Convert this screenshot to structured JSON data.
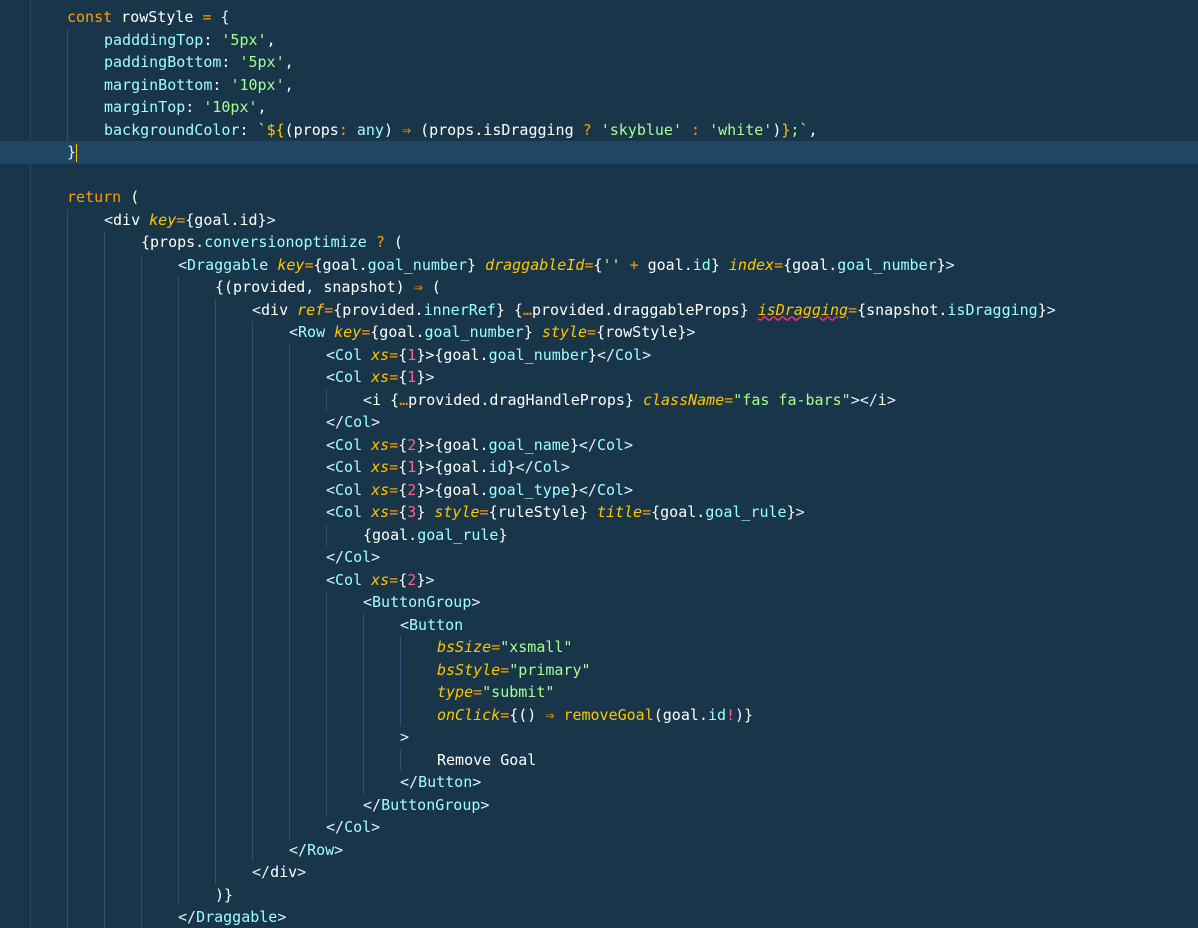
{
  "editor": {
    "theme_colors": {
      "background": "#193549",
      "current_line": "#1f4662",
      "keyword": "#ff9d00",
      "string": "#a5ff90",
      "number": "#ff628c",
      "tag": "#9effff",
      "attribute": "#ffc600"
    },
    "lines": [
      {
        "indent": 1,
        "tokens": [
          [
            "kw",
            "const"
          ],
          [
            "plain",
            " rowStyle "
          ],
          [
            "op",
            "="
          ],
          [
            "plain",
            " "
          ],
          [
            "punc",
            "{"
          ]
        ]
      },
      {
        "indent": 2,
        "tokens": [
          [
            "prop",
            "padddingTop"
          ],
          [
            "plain",
            ": "
          ],
          [
            "str",
            "'5px'"
          ],
          [
            "plain",
            ","
          ]
        ]
      },
      {
        "indent": 2,
        "tokens": [
          [
            "prop",
            "paddingBottom"
          ],
          [
            "plain",
            ": "
          ],
          [
            "str",
            "'5px'"
          ],
          [
            "plain",
            ","
          ]
        ]
      },
      {
        "indent": 2,
        "tokens": [
          [
            "prop",
            "marginBottom"
          ],
          [
            "plain",
            ": "
          ],
          [
            "str",
            "'10px'"
          ],
          [
            "plain",
            ","
          ]
        ]
      },
      {
        "indent": 2,
        "tokens": [
          [
            "prop",
            "marginTop"
          ],
          [
            "plain",
            ": "
          ],
          [
            "str",
            "'10px'"
          ],
          [
            "plain",
            ","
          ]
        ]
      },
      {
        "indent": 2,
        "tokens": [
          [
            "prop",
            "backgroundColor"
          ],
          [
            "plain",
            ": "
          ],
          [
            "str",
            "`"
          ],
          [
            "fn",
            "${"
          ],
          [
            "plain",
            "(props"
          ],
          [
            "op",
            ":"
          ],
          [
            "plain",
            " "
          ],
          [
            "type",
            "any"
          ],
          [
            "plain",
            ") "
          ],
          [
            "op",
            "⇒"
          ],
          [
            "plain",
            " (props.isDragging "
          ],
          [
            "op",
            "?"
          ],
          [
            "plain",
            " "
          ],
          [
            "str",
            "'skyblue'"
          ],
          [
            "plain",
            " "
          ],
          [
            "op",
            ":"
          ],
          [
            "plain",
            " "
          ],
          [
            "str",
            "'white'"
          ],
          [
            "plain",
            ")"
          ],
          [
            "fn",
            "}"
          ],
          [
            "str",
            ";`"
          ],
          [
            "plain",
            ","
          ]
        ]
      },
      {
        "indent": 1,
        "current": true,
        "tokens": [
          [
            "punc",
            "}"
          ]
        ]
      },
      {
        "indent": 0,
        "tokens": []
      },
      {
        "indent": 1,
        "tokens": [
          [
            "kw",
            "return"
          ],
          [
            "plain",
            " ("
          ]
        ]
      },
      {
        "indent": 2,
        "tokens": [
          [
            "punc",
            "<"
          ],
          [
            "plain",
            "div "
          ],
          [
            "attr",
            "key"
          ],
          [
            "op",
            "="
          ],
          [
            "plain",
            "{goal.id}"
          ],
          [
            "punc",
            ">"
          ]
        ]
      },
      {
        "indent": 3,
        "tokens": [
          [
            "plain",
            "{props."
          ],
          [
            "prop",
            "conversionoptimize"
          ],
          [
            "plain",
            " "
          ],
          [
            "op",
            "?"
          ],
          [
            "plain",
            " ("
          ]
        ]
      },
      {
        "indent": 4,
        "tokens": [
          [
            "punc",
            "<"
          ],
          [
            "tag",
            "Draggable"
          ],
          [
            "plain",
            " "
          ],
          [
            "attr",
            "key"
          ],
          [
            "op",
            "="
          ],
          [
            "plain",
            "{goal."
          ],
          [
            "prop",
            "goal_number"
          ],
          [
            "plain",
            "} "
          ],
          [
            "attr",
            "draggableId"
          ],
          [
            "op",
            "="
          ],
          [
            "plain",
            "{"
          ],
          [
            "str",
            "''"
          ],
          [
            "plain",
            " "
          ],
          [
            "op",
            "+"
          ],
          [
            "plain",
            " goal."
          ],
          [
            "prop",
            "id"
          ],
          [
            "plain",
            "} "
          ],
          [
            "attr",
            "index"
          ],
          [
            "op",
            "="
          ],
          [
            "plain",
            "{goal."
          ],
          [
            "prop",
            "goal_number"
          ],
          [
            "plain",
            "}"
          ],
          [
            "punc",
            ">"
          ]
        ]
      },
      {
        "indent": 5,
        "tokens": [
          [
            "plain",
            "{(provided, snapshot) "
          ],
          [
            "op",
            "⇒"
          ],
          [
            "plain",
            " ("
          ]
        ]
      },
      {
        "indent": 6,
        "tokens": [
          [
            "punc",
            "<"
          ],
          [
            "plain",
            "div "
          ],
          [
            "attr",
            "ref"
          ],
          [
            "op",
            "="
          ],
          [
            "plain",
            "{provided."
          ],
          [
            "prop",
            "innerRef"
          ],
          [
            "plain",
            "} {"
          ],
          [
            "op",
            "…"
          ],
          [
            "plain",
            "provided.draggableProps} "
          ],
          [
            "err",
            "isDragging"
          ],
          [
            "op",
            "="
          ],
          [
            "plain",
            "{snapshot."
          ],
          [
            "prop",
            "isDragging"
          ],
          [
            "plain",
            "}"
          ],
          [
            "punc",
            ">"
          ]
        ]
      },
      {
        "indent": 7,
        "tokens": [
          [
            "punc",
            "<"
          ],
          [
            "tag",
            "Row"
          ],
          [
            "plain",
            " "
          ],
          [
            "attr",
            "key"
          ],
          [
            "op",
            "="
          ],
          [
            "plain",
            "{goal."
          ],
          [
            "prop",
            "goal_number"
          ],
          [
            "plain",
            "} "
          ],
          [
            "attr",
            "style"
          ],
          [
            "op",
            "="
          ],
          [
            "plain",
            "{rowStyle}"
          ],
          [
            "punc",
            ">"
          ]
        ]
      },
      {
        "indent": 8,
        "tokens": [
          [
            "punc",
            "<"
          ],
          [
            "tag",
            "Col"
          ],
          [
            "plain",
            " "
          ],
          [
            "attr",
            "xs"
          ],
          [
            "op",
            "="
          ],
          [
            "plain",
            "{"
          ],
          [
            "num",
            "1"
          ],
          [
            "plain",
            "}>{goal."
          ],
          [
            "prop",
            "goal_number"
          ],
          [
            "plain",
            "}"
          ],
          [
            "punc",
            "</"
          ],
          [
            "tag",
            "Col"
          ],
          [
            "punc",
            ">"
          ]
        ]
      },
      {
        "indent": 8,
        "tokens": [
          [
            "punc",
            "<"
          ],
          [
            "tag",
            "Col"
          ],
          [
            "plain",
            " "
          ],
          [
            "attr",
            "xs"
          ],
          [
            "op",
            "="
          ],
          [
            "plain",
            "{"
          ],
          [
            "num",
            "1"
          ],
          [
            "plain",
            "}"
          ],
          [
            "punc",
            ">"
          ]
        ]
      },
      {
        "indent": 9,
        "tokens": [
          [
            "punc",
            "<"
          ],
          [
            "plain",
            "i {"
          ],
          [
            "op",
            "…"
          ],
          [
            "plain",
            "provided.dragHandleProps} "
          ],
          [
            "attr",
            "className"
          ],
          [
            "op",
            "="
          ],
          [
            "str",
            "\"fas fa-bars\""
          ],
          [
            "punc",
            "></"
          ],
          [
            "plain",
            "i"
          ],
          [
            "punc",
            ">"
          ]
        ]
      },
      {
        "indent": 8,
        "tokens": [
          [
            "punc",
            "</"
          ],
          [
            "tag",
            "Col"
          ],
          [
            "punc",
            ">"
          ]
        ]
      },
      {
        "indent": 8,
        "tokens": [
          [
            "punc",
            "<"
          ],
          [
            "tag",
            "Col"
          ],
          [
            "plain",
            " "
          ],
          [
            "attr",
            "xs"
          ],
          [
            "op",
            "="
          ],
          [
            "plain",
            "{"
          ],
          [
            "num",
            "2"
          ],
          [
            "plain",
            "}>{goal."
          ],
          [
            "prop",
            "goal_name"
          ],
          [
            "plain",
            "}"
          ],
          [
            "punc",
            "</"
          ],
          [
            "tag",
            "Col"
          ],
          [
            "punc",
            ">"
          ]
        ]
      },
      {
        "indent": 8,
        "tokens": [
          [
            "punc",
            "<"
          ],
          [
            "tag",
            "Col"
          ],
          [
            "plain",
            " "
          ],
          [
            "attr",
            "xs"
          ],
          [
            "op",
            "="
          ],
          [
            "plain",
            "{"
          ],
          [
            "num",
            "1"
          ],
          [
            "plain",
            "}>{goal."
          ],
          [
            "prop",
            "id"
          ],
          [
            "plain",
            "}"
          ],
          [
            "punc",
            "</"
          ],
          [
            "tag",
            "Col"
          ],
          [
            "punc",
            ">"
          ]
        ]
      },
      {
        "indent": 8,
        "tokens": [
          [
            "punc",
            "<"
          ],
          [
            "tag",
            "Col"
          ],
          [
            "plain",
            " "
          ],
          [
            "attr",
            "xs"
          ],
          [
            "op",
            "="
          ],
          [
            "plain",
            "{"
          ],
          [
            "num",
            "2"
          ],
          [
            "plain",
            "}>{goal."
          ],
          [
            "prop",
            "goal_type"
          ],
          [
            "plain",
            "}"
          ],
          [
            "punc",
            "</"
          ],
          [
            "tag",
            "Col"
          ],
          [
            "punc",
            ">"
          ]
        ]
      },
      {
        "indent": 8,
        "tokens": [
          [
            "punc",
            "<"
          ],
          [
            "tag",
            "Col"
          ],
          [
            "plain",
            " "
          ],
          [
            "attr",
            "xs"
          ],
          [
            "op",
            "="
          ],
          [
            "plain",
            "{"
          ],
          [
            "num",
            "3"
          ],
          [
            "plain",
            "} "
          ],
          [
            "attr",
            "style"
          ],
          [
            "op",
            "="
          ],
          [
            "plain",
            "{ruleStyle} "
          ],
          [
            "attr",
            "title"
          ],
          [
            "op",
            "="
          ],
          [
            "plain",
            "{goal."
          ],
          [
            "prop",
            "goal_rule"
          ],
          [
            "plain",
            "}"
          ],
          [
            "punc",
            ">"
          ]
        ]
      },
      {
        "indent": 9,
        "tokens": [
          [
            "plain",
            "{goal."
          ],
          [
            "prop",
            "goal_rule"
          ],
          [
            "plain",
            "}"
          ]
        ]
      },
      {
        "indent": 8,
        "tokens": [
          [
            "punc",
            "</"
          ],
          [
            "tag",
            "Col"
          ],
          [
            "punc",
            ">"
          ]
        ]
      },
      {
        "indent": 8,
        "tokens": [
          [
            "punc",
            "<"
          ],
          [
            "tag",
            "Col"
          ],
          [
            "plain",
            " "
          ],
          [
            "attr",
            "xs"
          ],
          [
            "op",
            "="
          ],
          [
            "plain",
            "{"
          ],
          [
            "num",
            "2"
          ],
          [
            "plain",
            "}"
          ],
          [
            "punc",
            ">"
          ]
        ]
      },
      {
        "indent": 9,
        "tokens": [
          [
            "punc",
            "<"
          ],
          [
            "tag",
            "ButtonGroup"
          ],
          [
            "punc",
            ">"
          ]
        ]
      },
      {
        "indent": 10,
        "tokens": [
          [
            "punc",
            "<"
          ],
          [
            "tag",
            "Button"
          ]
        ]
      },
      {
        "indent": 11,
        "tokens": [
          [
            "attr",
            "bsSize"
          ],
          [
            "op",
            "="
          ],
          [
            "str",
            "\"xsmall\""
          ]
        ]
      },
      {
        "indent": 11,
        "tokens": [
          [
            "attr",
            "bsStyle"
          ],
          [
            "op",
            "="
          ],
          [
            "str",
            "\"primary\""
          ]
        ]
      },
      {
        "indent": 11,
        "tokens": [
          [
            "attr",
            "type"
          ],
          [
            "op",
            "="
          ],
          [
            "str",
            "\"submit\""
          ]
        ]
      },
      {
        "indent": 11,
        "tokens": [
          [
            "attr",
            "onClick"
          ],
          [
            "op",
            "="
          ],
          [
            "plain",
            "{() "
          ],
          [
            "op",
            "⇒"
          ],
          [
            "plain",
            " "
          ],
          [
            "fn",
            "removeGoal"
          ],
          [
            "plain",
            "(goal."
          ],
          [
            "prop",
            "id"
          ],
          [
            "num",
            "!"
          ],
          [
            "plain",
            ")}"
          ]
        ]
      },
      {
        "indent": 10,
        "tokens": [
          [
            "punc",
            ">"
          ]
        ]
      },
      {
        "indent": 11,
        "tokens": [
          [
            "plain",
            "Remove Goal"
          ]
        ]
      },
      {
        "indent": 10,
        "tokens": [
          [
            "punc",
            "</"
          ],
          [
            "tag",
            "Button"
          ],
          [
            "punc",
            ">"
          ]
        ]
      },
      {
        "indent": 9,
        "tokens": [
          [
            "punc",
            "</"
          ],
          [
            "tag",
            "ButtonGroup"
          ],
          [
            "punc",
            ">"
          ]
        ]
      },
      {
        "indent": 8,
        "tokens": [
          [
            "punc",
            "</"
          ],
          [
            "tag",
            "Col"
          ],
          [
            "punc",
            ">"
          ]
        ]
      },
      {
        "indent": 7,
        "tokens": [
          [
            "punc",
            "</"
          ],
          [
            "tag",
            "Row"
          ],
          [
            "punc",
            ">"
          ]
        ]
      },
      {
        "indent": 6,
        "tokens": [
          [
            "punc",
            "</"
          ],
          [
            "plain",
            "div"
          ],
          [
            "punc",
            ">"
          ]
        ]
      },
      {
        "indent": 5,
        "tokens": [
          [
            "plain",
            ")}"
          ]
        ]
      },
      {
        "indent": 4,
        "tokens": [
          [
            "punc",
            "</"
          ],
          [
            "tag",
            "Draggable"
          ],
          [
            "punc",
            ">"
          ]
        ]
      }
    ]
  }
}
